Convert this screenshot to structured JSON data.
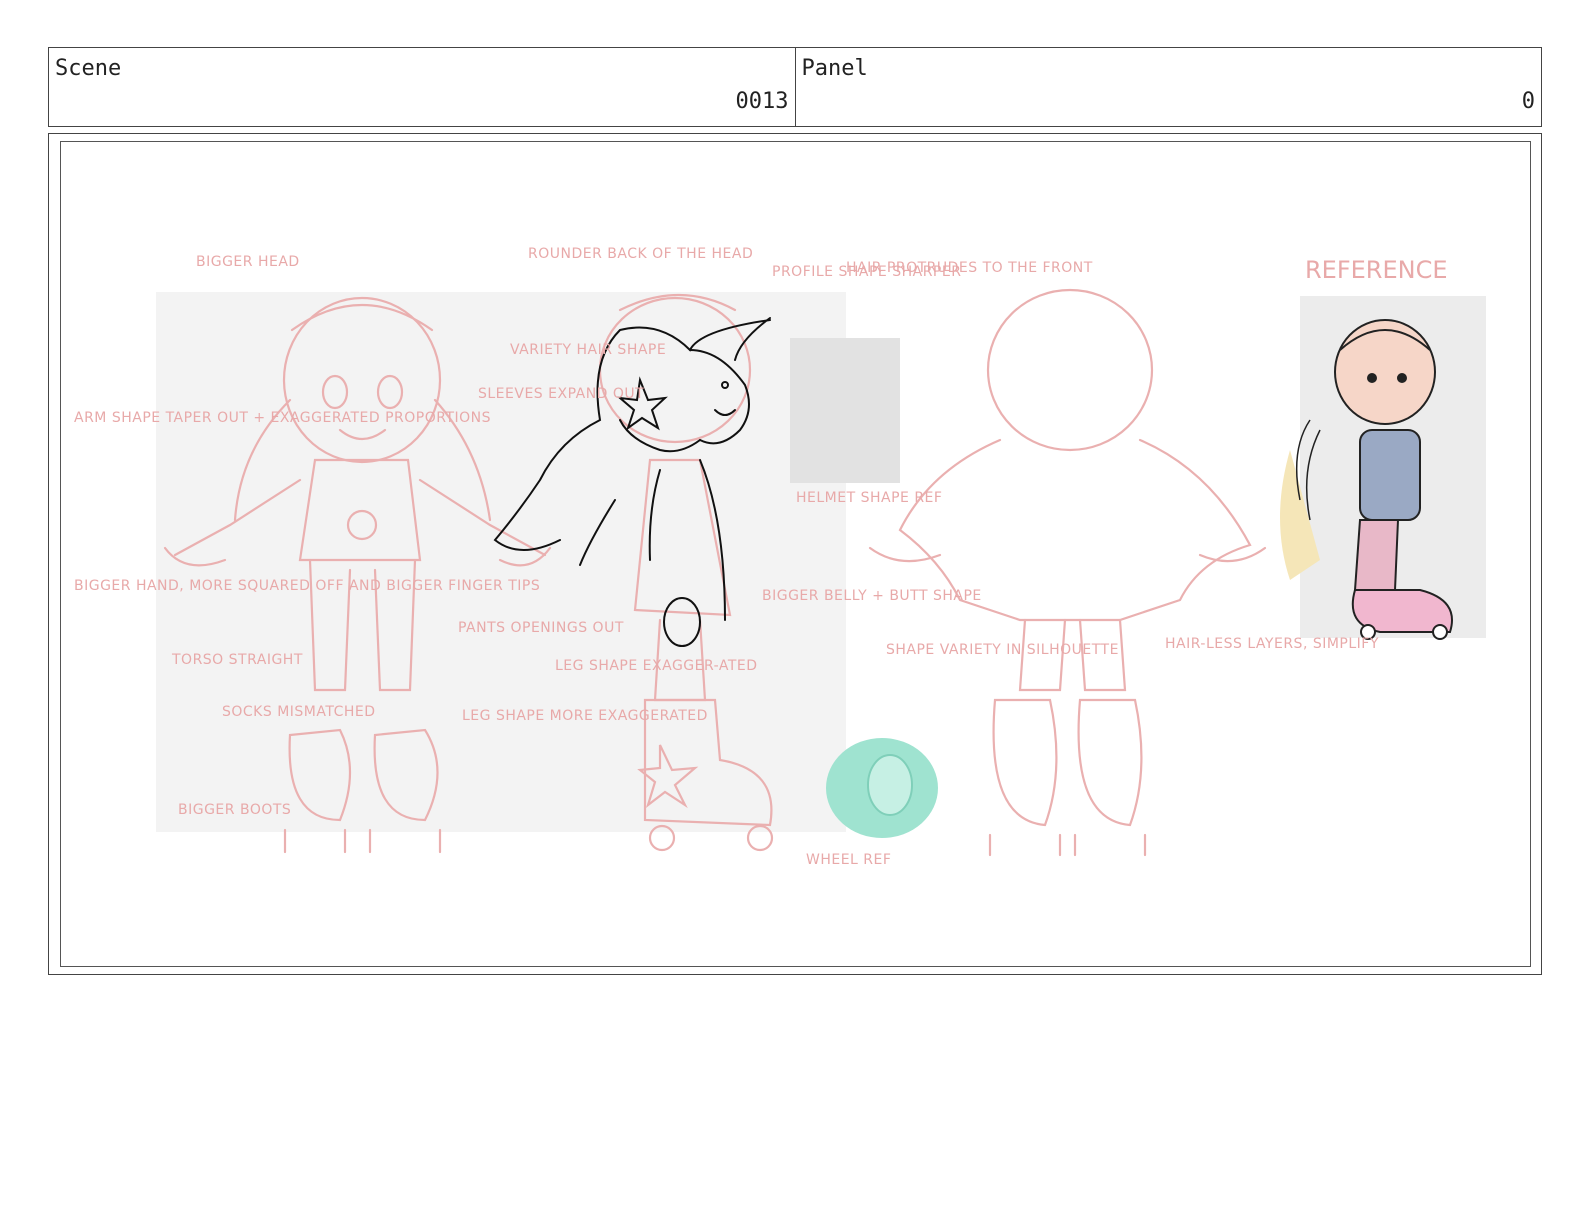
{
  "header": {
    "scene_label": "Scene",
    "scene_value": "0013",
    "panel_label": "Panel",
    "panel_value": "0"
  },
  "annotations": {
    "bigger_head": "BIGGER HEAD",
    "rounder_back": "ROUNDER BACK OF THE HEAD",
    "profile_shape": "PROFILE SHAPE SHARPER",
    "hair_protrudes": "HAIR PROTRUDES TO THE FRONT",
    "reference": "REFERENCE",
    "variety_hair": "VARIETY HAIR SHAPE",
    "sleeves": "SLEEVES EXPAND OUT",
    "arm_shape": "ARM SHAPE TAPER OUT + EXAGGERATED PROPORTIONS",
    "helmet_ref": "HELMET SHAPE REF",
    "bigger_hand": "BIGGER HAND, MORE SQUARED OFF AND BIGGER FINGER TIPS",
    "torso": "TORSO STRAIGHT",
    "pants": "PANTS OPENINGS OUT",
    "leg_shape_exag": "LEG SHAPE EXAGGER-ATED",
    "belly": "BIGGER BELLY + BUTT SHAPE",
    "shape_variety": "SHAPE VARIETY IN SILHOUETTE",
    "hairless": "HAIR-LESS LAYERS, SIMPLIFY",
    "socks": "SOCKS MISMATCHED",
    "leg_shape_more": "LEG SHAPE MORE EXAGGERATED",
    "bigger_boots": "BIGGER BOOTS",
    "wheel_ref": "WHEEL REF"
  },
  "colors": {
    "sketch_red": "#eab0b0",
    "line_black": "#111111",
    "wheel_teal": "#9fe3d0"
  }
}
